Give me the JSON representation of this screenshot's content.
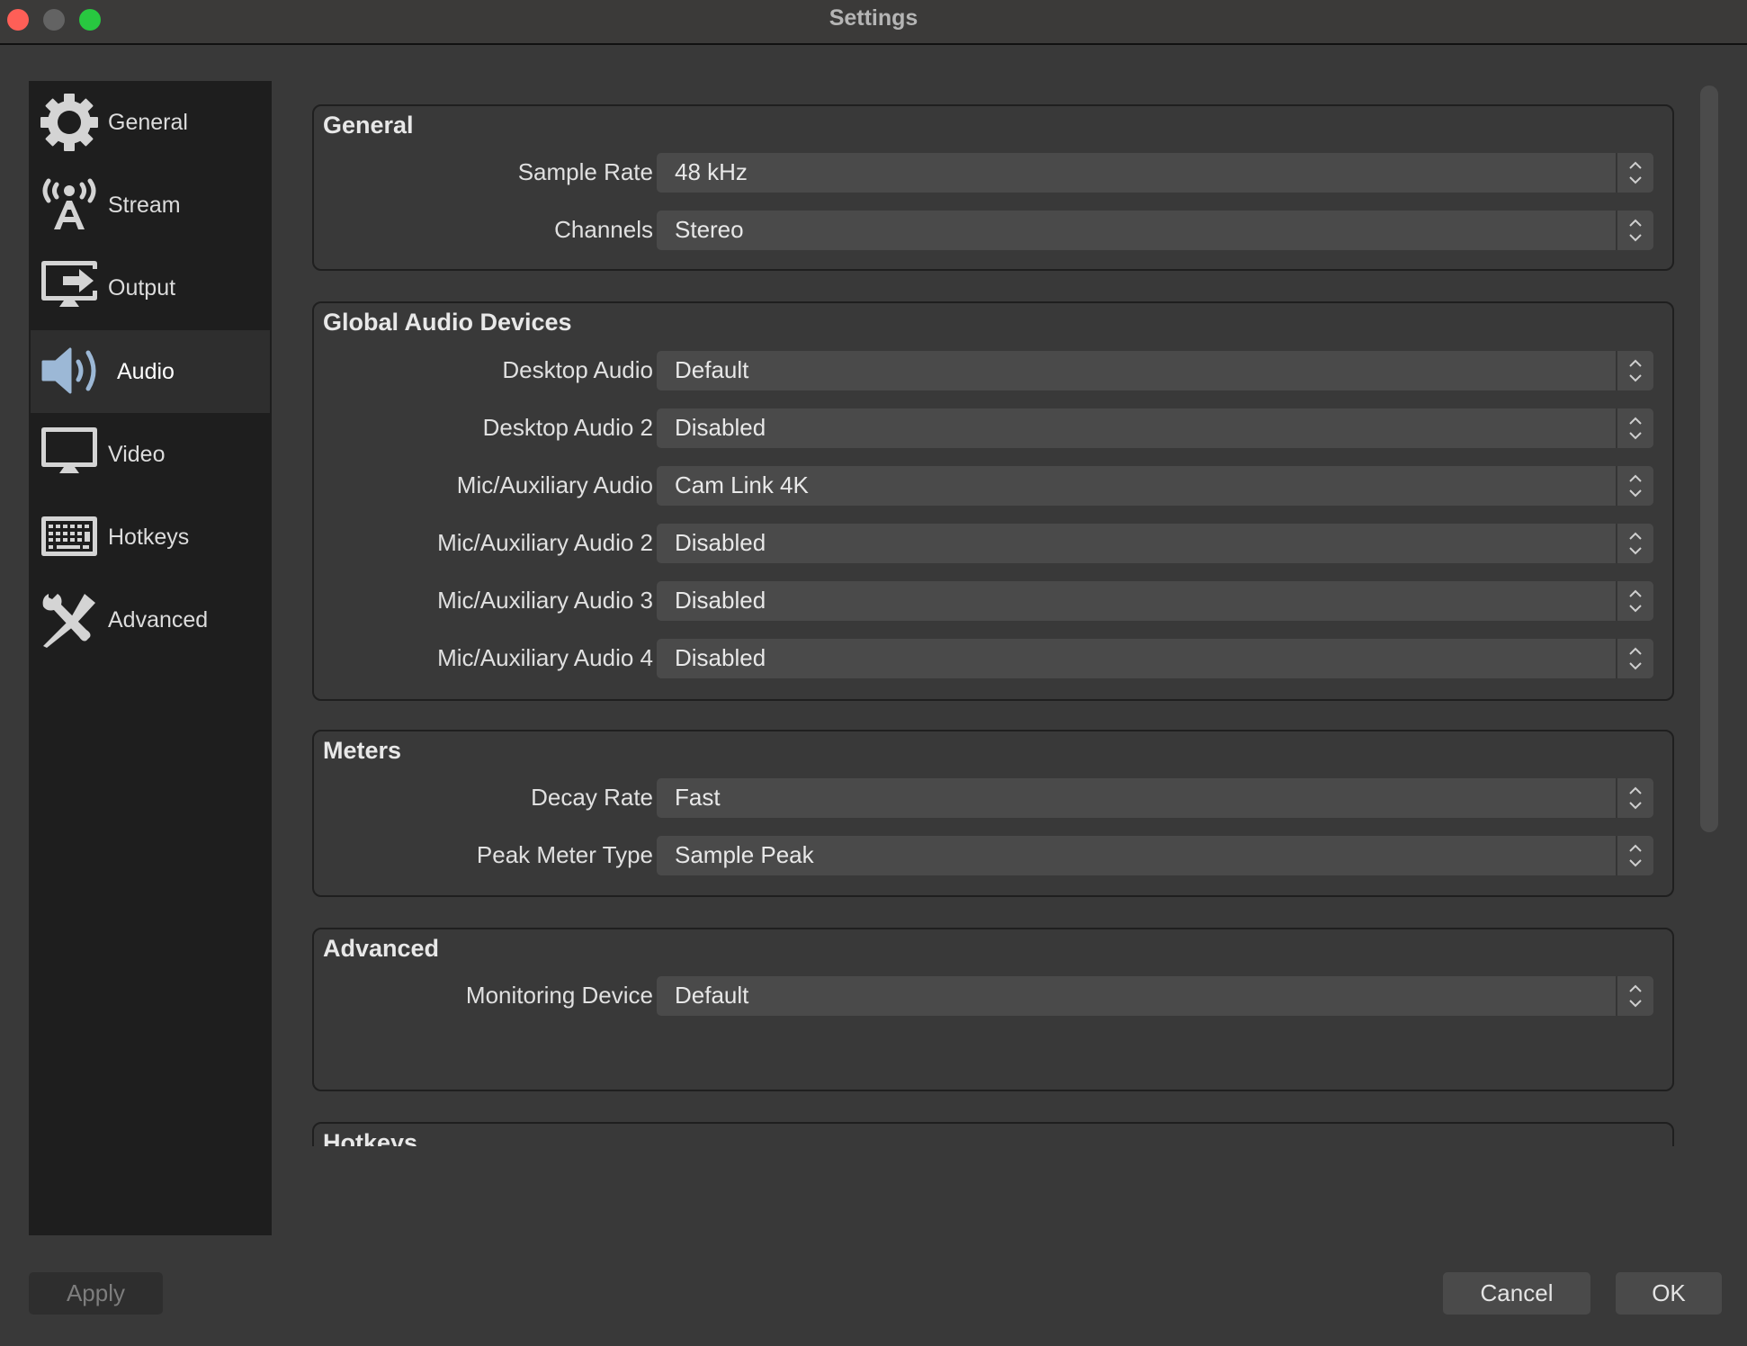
{
  "window": {
    "title": "Settings",
    "controls": [
      "close",
      "minimize",
      "zoom"
    ]
  },
  "sidebar": {
    "items": [
      {
        "label": "General",
        "icon": "gear-icon"
      },
      {
        "label": "Stream",
        "icon": "broadcast-tower-icon"
      },
      {
        "label": "Output",
        "icon": "monitor-output-icon"
      },
      {
        "label": "Audio",
        "icon": "speaker-icon",
        "active": true
      },
      {
        "label": "Video",
        "icon": "monitor-icon"
      },
      {
        "label": "Hotkeys",
        "icon": "keyboard-icon"
      },
      {
        "label": "Advanced",
        "icon": "tools-icon"
      }
    ]
  },
  "groups": {
    "general": {
      "title": "General",
      "rows": [
        {
          "label": "Sample Rate",
          "value": "48 kHz"
        },
        {
          "label": "Channels",
          "value": "Stereo"
        }
      ]
    },
    "devices": {
      "title": "Global Audio Devices",
      "rows": [
        {
          "label": "Desktop Audio",
          "value": "Default"
        },
        {
          "label": "Desktop Audio 2",
          "value": "Disabled"
        },
        {
          "label": "Mic/Auxiliary Audio",
          "value": "Cam Link 4K"
        },
        {
          "label": "Mic/Auxiliary Audio 2",
          "value": "Disabled"
        },
        {
          "label": "Mic/Auxiliary Audio 3",
          "value": "Disabled"
        },
        {
          "label": "Mic/Auxiliary Audio 4",
          "value": "Disabled"
        }
      ]
    },
    "meters": {
      "title": "Meters",
      "rows": [
        {
          "label": "Decay Rate",
          "value": "Fast"
        },
        {
          "label": "Peak Meter Type",
          "value": "Sample Peak"
        }
      ]
    },
    "advanced": {
      "title": "Advanced",
      "rows": [
        {
          "label": "Monitoring Device",
          "value": "Default"
        }
      ]
    },
    "hotkeys": {
      "title": "Hotkeys"
    }
  },
  "buttons": {
    "apply": "Apply",
    "cancel": "Cancel",
    "ok": "OK"
  },
  "colors": {
    "active_icon": "#9cb8d6",
    "icon": "#d4d4d4",
    "close": "#fe5f57",
    "minimize": "#636363",
    "zoom": "#28c840"
  }
}
